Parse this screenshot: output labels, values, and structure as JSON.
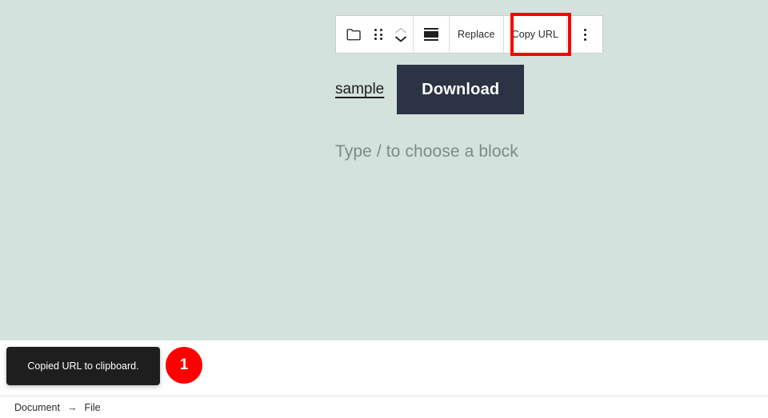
{
  "canvas": {
    "background_color": "#d3e2dc"
  },
  "toolbar": {
    "block_type_icon": "folder-icon",
    "drag_handle_icon": "drag-handle-icon",
    "move_up_icon": "chevron-up-icon",
    "move_down_icon": "chevron-down-icon",
    "align_icon": "align-center-icon",
    "replace_label": "Replace",
    "copy_url_label": "Copy URL",
    "more_options_icon": "more-vertical-icon",
    "highlight_color": "#f90000",
    "highlighted_button": "Copy URL"
  },
  "file_block": {
    "link_label": "sample",
    "download_label": "Download",
    "download_bg": "#2b3345"
  },
  "paragraph": {
    "placeholder": "Type / to choose a block"
  },
  "snackbar": {
    "message": "Copied URL to clipboard.",
    "background": "#1e1e1e"
  },
  "step_badge": {
    "number": "1",
    "color": "#ff0000"
  },
  "breadcrumb": {
    "items": [
      {
        "label": "Document"
      },
      {
        "label": "File"
      }
    ],
    "separator": "→"
  }
}
